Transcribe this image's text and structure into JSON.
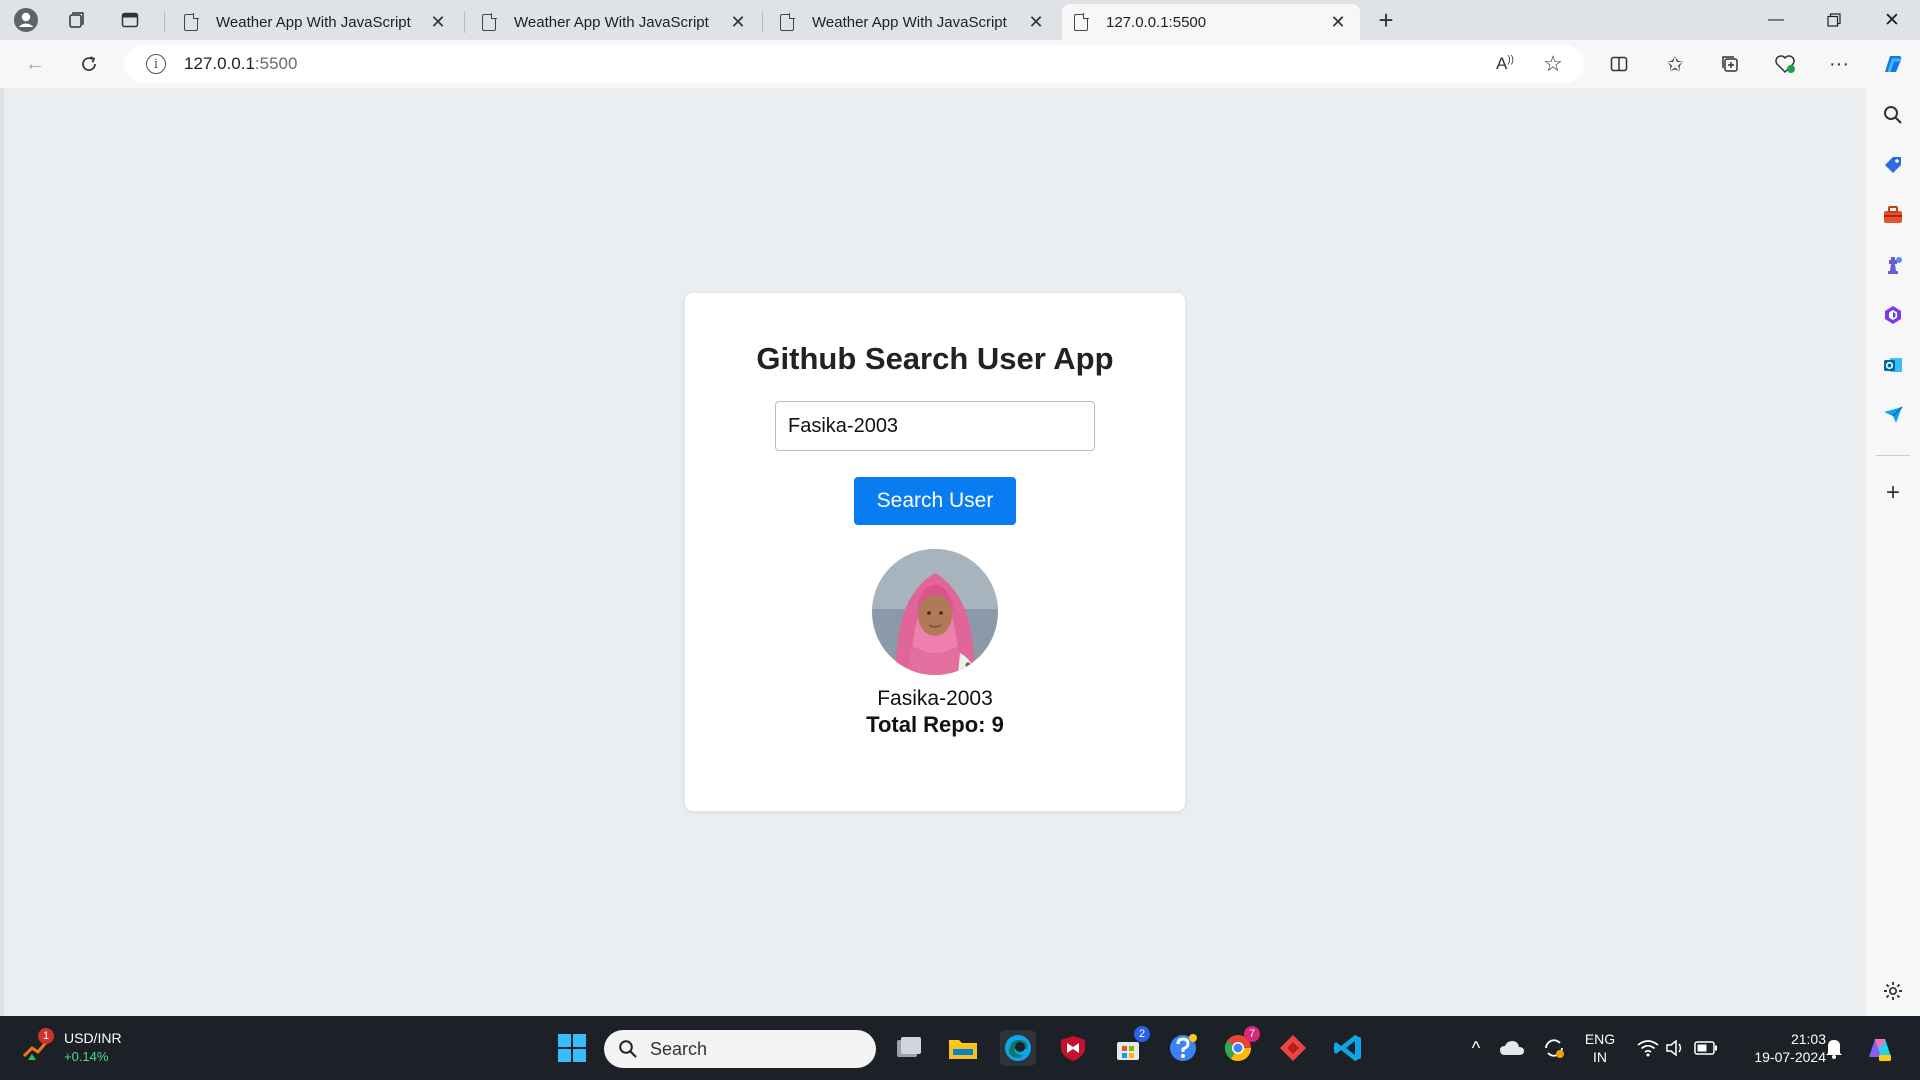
{
  "browser": {
    "tabs": [
      {
        "title": "Weather App With JavaScript",
        "active": false
      },
      {
        "title": "Weather App With JavaScript",
        "active": false
      },
      {
        "title": "Weather App With JavaScript",
        "active": false
      },
      {
        "title": "127.0.0.1:5500",
        "active": true
      }
    ],
    "url": {
      "host": "127.0.0.1",
      "port": ":5500"
    }
  },
  "app": {
    "title": "Github Search User App",
    "search_value": "Fasika-2003",
    "search_button": "Search User",
    "result": {
      "username": "Fasika-2003",
      "repos_text": "Total Repo: 9"
    }
  },
  "taskbar": {
    "widget": {
      "label": "USD/INR",
      "change": "+0.14%",
      "badge": "1"
    },
    "search_placeholder": "Search",
    "store_badge": "2",
    "chrome_badge": "7",
    "lang": {
      "line1": "ENG",
      "line2": "IN"
    },
    "clock": {
      "time": "21:03",
      "date": "19-07-2024"
    }
  },
  "colors": {
    "accent": "#0a7cf2",
    "page_bg": "#ebeef1",
    "taskbar": "#1c2128"
  }
}
